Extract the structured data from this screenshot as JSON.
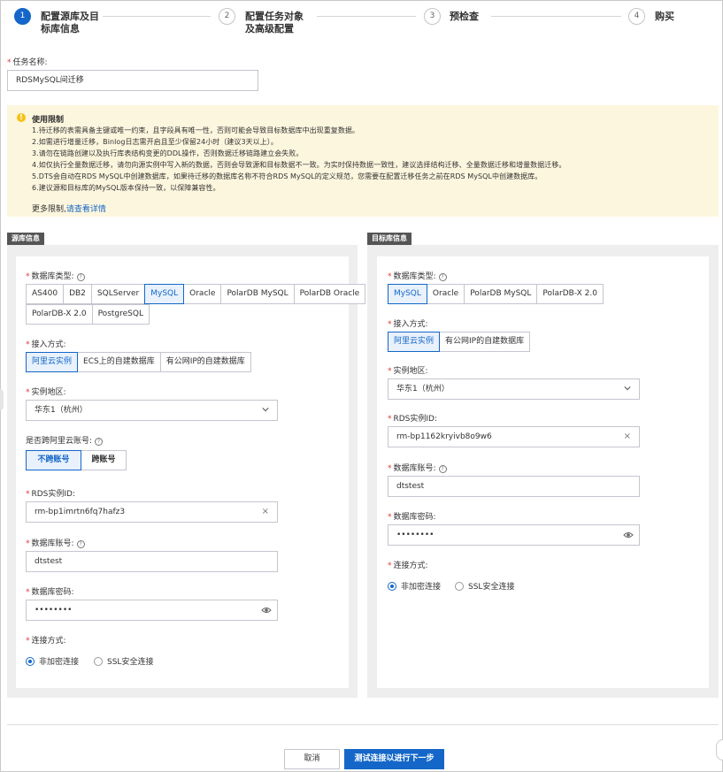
{
  "steps": [
    {
      "num": "1",
      "line1": "配置源库及目",
      "line2": "标库信息"
    },
    {
      "num": "2",
      "line1": "配置任务对象",
      "line2": "及高级配置"
    },
    {
      "num": "3",
      "line1": "预检查",
      "line2": ""
    },
    {
      "num": "4",
      "line1": "购买",
      "line2": ""
    }
  ],
  "task": {
    "label": "任务名称:",
    "value": "RDSMySQL间迁移"
  },
  "notice": {
    "title": "使用限制",
    "lines": [
      "1.待迁移的表需具备主键或唯一约束，且字段具有唯一性，否则可能会导致目标数据库中出现重复数据。",
      "2.如需进行增量迁移，Binlog日志需开启且至少保留24小时（建议3天以上）。",
      "3.请勿在链路创建以及执行库表结构变更的DDL操作，否则数据迁移链路建立会失败。",
      "4.如仅执行全量数据迁移，请勿向源实例中写入新的数据，否则会导致源和目标数据不一致。为实时保持数据一致性，建议选择结构迁移、全量数据迁移和增量数据迁移。",
      "5.DTS会自动在RDS MySQL中创建数据库，如果待迁移的数据库名称不符合RDS MySQL的定义规范，您需要在配置迁移任务之前在RDS MySQL中创建数据库。",
      "6.建议源和目标库的MySQL版本保持一致，以保障兼容性。"
    ],
    "more_prefix": "更多限制,",
    "more_link": "请查看详情"
  },
  "source": {
    "tag": "源库信息",
    "db_type_label": "数据库类型:",
    "db_types_row1": [
      "AS400",
      "DB2",
      "SQLServer",
      "MySQL",
      "Oracle",
      "PolarDB MySQL",
      "PolarDB Oracle"
    ],
    "db_types_row2": [
      "PolarDB-X 2.0",
      "PostgreSQL"
    ],
    "db_type_selected": "MySQL",
    "access_label": "接入方式:",
    "access_options": [
      "阿里云实例",
      "ECS上的自建数据库",
      "有公网IP的自建数据库"
    ],
    "region_label": "实例地区:",
    "region_value": "华东1（杭州）",
    "cross_label": "是否跨阿里云账号:",
    "cross_options": [
      "不跨账号",
      "跨账号"
    ],
    "rds_label": "RDS实例ID:",
    "rds_value": "rm-bp1imrtn6fq7hafz3",
    "account_label": "数据库账号:",
    "account_value": "dtstest",
    "password_label": "数据库密码:",
    "password_value": "••••••••",
    "conn_label": "连接方式:",
    "conn_options": [
      "非加密连接",
      "SSL安全连接"
    ]
  },
  "target": {
    "tag": "目标库信息",
    "db_type_label": "数据库类型:",
    "db_types": [
      "MySQL",
      "Oracle",
      "PolarDB MySQL",
      "PolarDB-X 2.0"
    ],
    "access_label": "接入方式:",
    "access_options": [
      "阿里云实例",
      "有公网IP的自建数据库"
    ],
    "region_label": "实例地区:",
    "region_value": "华东1（杭州）",
    "rds_label": "RDS实例ID:",
    "rds_value": "rm-bp1162kryivb8o9w6",
    "account_label": "数据库账号:",
    "account_value": "dtstest",
    "password_label": "数据库密码:",
    "password_value": "••••••••",
    "conn_label": "连接方式:",
    "conn_options": [
      "非加密连接",
      "SSL安全连接"
    ]
  },
  "footer": {
    "cancel": "取消",
    "next": "测试连接以进行下一步"
  },
  "colors": {
    "primary": "#1467c8",
    "notice_bg": "#fdf6de",
    "required": "#e5342c"
  }
}
